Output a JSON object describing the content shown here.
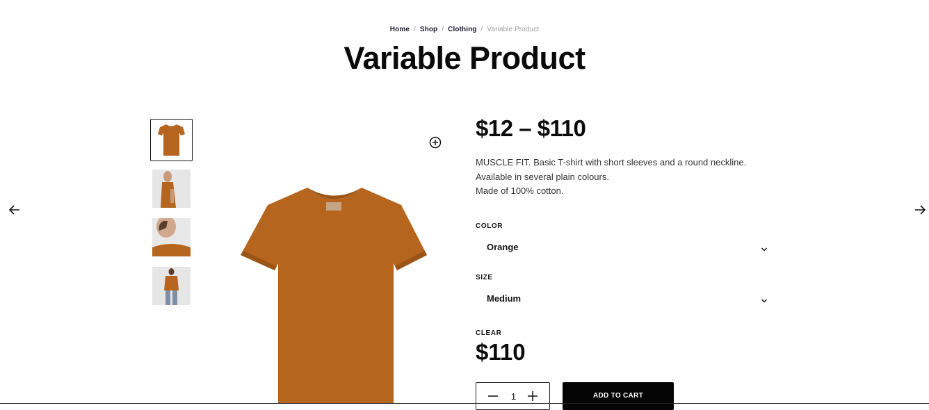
{
  "breadcrumb": {
    "items": [
      "Home",
      "Shop",
      "Clothing"
    ],
    "separator": "/",
    "current": "Variable Product"
  },
  "product": {
    "title": "Variable Product",
    "price_range": "$12 – $110",
    "description": [
      "MUSCLE FIT. Basic T-shirt with short sleeves and a round neckline.",
      "Available in several plain colours.",
      "Made of 100% cotton."
    ],
    "color_label": "COLOR",
    "color_value": "Orange",
    "size_label": "SIZE",
    "size_value": "Medium",
    "clear_label": "CLEAR",
    "variation_price": "$110",
    "quantity": "1",
    "add_to_cart_label": "ADD TO CART"
  },
  "gallery": {
    "thumbnails": [
      "tshirt-front",
      "model-side",
      "model-neck-closeup",
      "model-full-body"
    ],
    "active_index": 0
  },
  "colors": {
    "shirt": "#b5651d",
    "shirt_shadow": "#9a5416",
    "text": "#111111",
    "button_bg": "#050505",
    "button_text": "#ffffff"
  },
  "icons": {
    "prev": "arrow-left-icon",
    "next": "arrow-right-icon",
    "zoom": "zoom-plus-icon",
    "dropdown": "chevron-down-icon",
    "minus": "minus-icon",
    "plus": "plus-icon"
  }
}
